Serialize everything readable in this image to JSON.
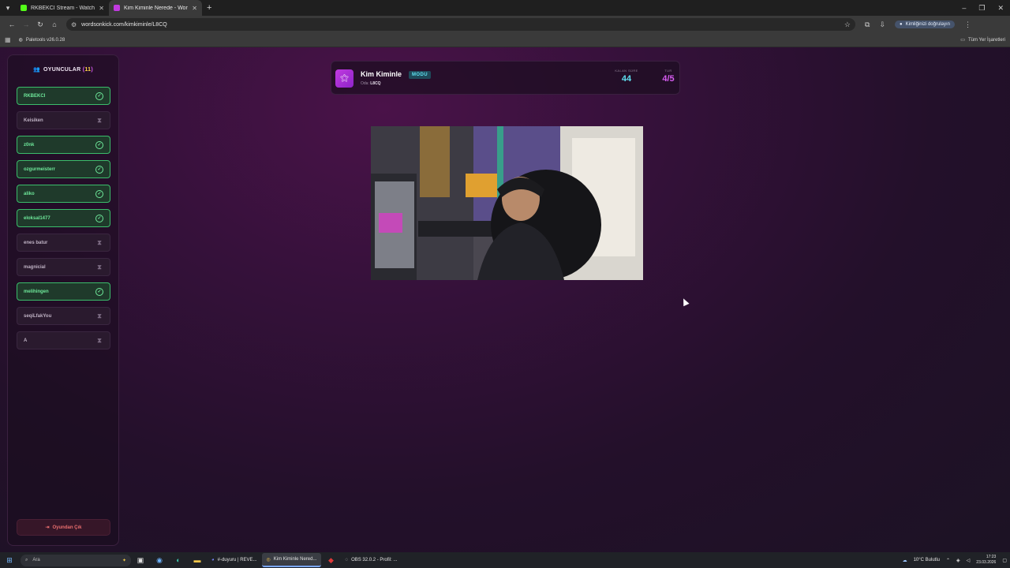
{
  "browser": {
    "tabs": [
      {
        "title": "RKBEKCI Stream - Watch Live o",
        "favicon_color": "#53fc18",
        "active": false
      },
      {
        "title": "Kim Kiminle Nerede - Words O",
        "favicon_color": "#c13ae0",
        "active": true
      }
    ],
    "new_tab": "+",
    "url": "wordsonkick.com/kimkiminle/L8CQ",
    "profile_label": "Kimliğinizi doğrulayın",
    "bookmark": "Paletools v26.0.28",
    "all_bookmarks": "Tüm Yer İşaretleri"
  },
  "sidebar": {
    "title": "OYUNCULAR",
    "count_open": "(",
    "count_value": "11",
    "count_close": ")",
    "players": [
      {
        "name": "RKBEKCI",
        "done": true
      },
      {
        "name": "Keisiken",
        "done": false
      },
      {
        "name": "z0nk",
        "done": true
      },
      {
        "name": "ozgurmeisterr",
        "done": true
      },
      {
        "name": "aliko",
        "done": true
      },
      {
        "name": "eloksal1477",
        "done": true
      },
      {
        "name": "enes batur",
        "done": false
      },
      {
        "name": "magnicial",
        "done": false
      },
      {
        "name": "melihingen",
        "done": true
      },
      {
        "name": "seqiLfakYou",
        "done": false
      },
      {
        "name": "A",
        "done": false
      }
    ],
    "leave_label": "Oyundan Çık"
  },
  "game": {
    "title": "Kim Kiminle",
    "mode": "MODU",
    "room_label": "Oda:",
    "room_code": "L8CQ",
    "time_label": "KALAN SÜRE",
    "time_value": "44",
    "round_label": "TUR",
    "round_value": "4/5"
  },
  "taskbar": {
    "search_placeholder": "Ara",
    "apps": [
      {
        "label": "#-duyuru | REVE...",
        "active": false
      },
      {
        "label": "Kim Kiminle Nered...",
        "active": true
      },
      {
        "label": "OBS 32.0.2 - Profil: ...",
        "active": false
      }
    ],
    "weather": "10°C  Bulutlu",
    "time": "17:23",
    "date": "23.03.2026"
  }
}
